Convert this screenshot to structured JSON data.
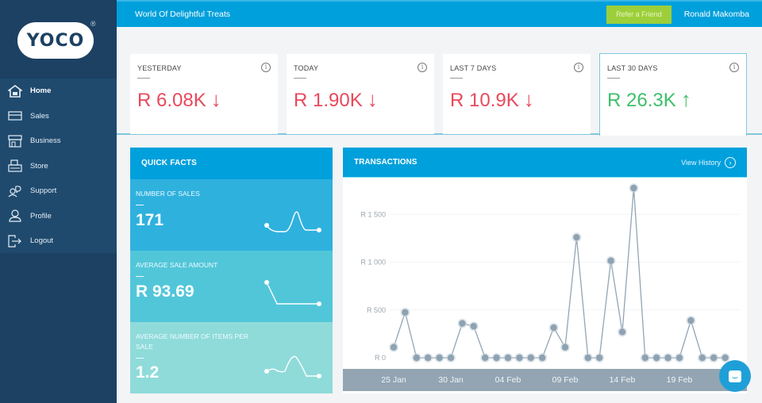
{
  "app": {
    "logo_text": "YOCO",
    "logo_mark": "®"
  },
  "sidebar": {
    "items": [
      {
        "label": "Home",
        "icon": "home-icon",
        "active": true
      },
      {
        "label": "Sales",
        "icon": "card-icon",
        "active": false
      },
      {
        "label": "Business",
        "icon": "storefront-icon",
        "active": false
      },
      {
        "label": "Store",
        "icon": "cash-register-icon",
        "active": false
      },
      {
        "label": "Support",
        "icon": "support-chat-icon",
        "active": false
      },
      {
        "label": "Profile",
        "icon": "user-icon",
        "active": false
      },
      {
        "label": "Logout",
        "icon": "logout-icon",
        "active": false
      }
    ]
  },
  "topbar": {
    "shop_name": "World Of Delightful Treats",
    "refer_label": "Refer a Friend",
    "user_name": "Ronald Makomba"
  },
  "stats": [
    {
      "label": "YESTERDAY",
      "value": "R 6.08K",
      "trend": "down",
      "arrow": "↓",
      "selected": false
    },
    {
      "label": "TODAY",
      "value": "R 1.90K",
      "trend": "down",
      "arrow": "↓",
      "selected": false
    },
    {
      "label": "LAST 7 DAYS",
      "value": "R 10.9K",
      "trend": "down",
      "arrow": "↓",
      "selected": false
    },
    {
      "label": "LAST 30 DAYS",
      "value": "R 26.3K",
      "trend": "up",
      "arrow": "↑",
      "selected": true
    }
  ],
  "info_glyph": "i",
  "quick_facts": {
    "title": "QUICK FACTS",
    "items": [
      {
        "label": "NUMBER OF SALES",
        "value": "171"
      },
      {
        "label": "AVERAGE SALE AMOUNT",
        "value": "R 93.69"
      },
      {
        "label": "AVERAGE NUMBER OF ITEMS PER SALE",
        "value": "1.2"
      }
    ]
  },
  "transactions": {
    "title": "TRANSACTIONS",
    "view_history": "View History",
    "view_history_icon": "›"
  },
  "chart_data": {
    "type": "line",
    "title": "TRANSACTIONS",
    "xlabel": "",
    "ylabel": "",
    "ylim": [
      0,
      1900
    ],
    "yticks": [
      0,
      500,
      1000,
      1500
    ],
    "ytick_labels": [
      "R 0",
      "R 500",
      "R 1 000",
      "R 1 500"
    ],
    "xtick_labels": [
      "25 Jan",
      "30 Jan",
      "04 Feb",
      "09 Feb",
      "14 Feb",
      "19 Feb"
    ],
    "xtick_indices": [
      0,
      5,
      10,
      15,
      20,
      25
    ],
    "grid": true,
    "series": [
      {
        "name": "Transactions",
        "color": "#93a5b3",
        "values": [
          110,
          475,
          0,
          0,
          0,
          0,
          360,
          330,
          0,
          0,
          0,
          0,
          0,
          0,
          315,
          110,
          1260,
          0,
          0,
          1015,
          270,
          1775,
          0,
          0,
          0,
          0,
          390,
          0,
          0,
          0
        ]
      }
    ]
  }
}
